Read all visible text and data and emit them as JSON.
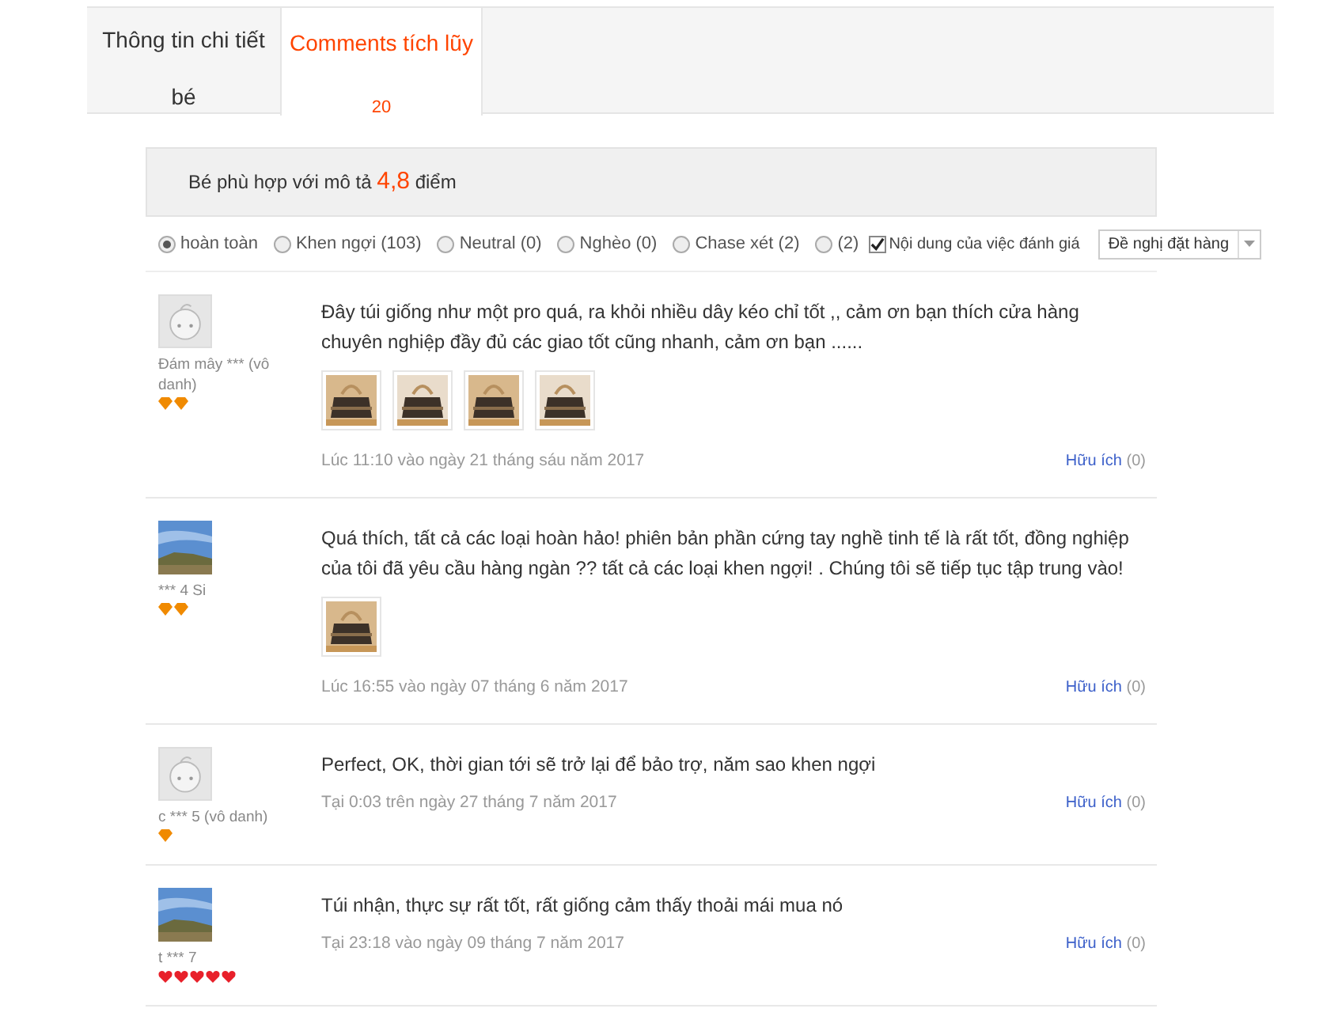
{
  "tabs": [
    {
      "label": "Thông tin chi tiết bé",
      "selected": false
    },
    {
      "label": "Comments tích lũy",
      "count": "20",
      "selected": true
    }
  ],
  "rating": {
    "label": "Bé phù hợp với mô tả",
    "score": "4,8",
    "unit": "điểm"
  },
  "filters": [
    {
      "label": "hoàn toàn",
      "selected": true
    },
    {
      "label": "Khen ngợi",
      "count": "(103)",
      "selected": false
    },
    {
      "label": "Neutral",
      "count": "(0)",
      "selected": false
    },
    {
      "label": "Nghèo",
      "count": "(0)",
      "selected": false
    },
    {
      "label": "Chase xét",
      "count": "(2)",
      "selected": false
    },
    {
      "count": "(2)",
      "selected": false
    }
  ],
  "content_filter": {
    "label": "Nội dung của việc đánh giá",
    "checked": true
  },
  "sort": {
    "value": "Đề nghị đặt hàng"
  },
  "reviews": [
    {
      "avatar": {
        "kind": "default"
      },
      "user": "Đám mây *** (vô danh)",
      "badges": [
        {
          "kind": "diamond"
        },
        {
          "kind": "diamond"
        }
      ],
      "text": "Đây túi giống như một pro quá, ra khỏi nhiều dây kéo chỉ tốt ,, cảm ơn bạn thích cửa hàng chuyên nghiệp đầy đủ các giao tốt cũng nhanh, cảm ơn bạn ......",
      "images": [
        {
          "kind": "picture"
        },
        {
          "kind": "picture"
        },
        {
          "kind": "picture"
        },
        {
          "kind": "picture"
        }
      ],
      "date": "Lúc 11:10 vào ngày 21 tháng sáu năm 2017",
      "helpful": "Hữu ích",
      "helpful_count": "(0)"
    },
    {
      "avatar": {
        "kind": "picture"
      },
      "user": "*** 4 Si",
      "badges": [
        {
          "kind": "diamond"
        },
        {
          "kind": "diamond"
        }
      ],
      "text": "Quá thích, tất cả các loại hoàn hảo! phiên bản phần cứng tay nghề tinh tế là rất tốt, đồng nghiệp của tôi đã yêu cầu hàng ngàn ?? tất cả các loại khen ngợi! . Chúng tôi sẽ tiếp tục tập trung vào!",
      "images": [
        {
          "kind": "picture"
        }
      ],
      "date": "Lúc 16:55 vào ngày 07 tháng 6 năm 2017",
      "helpful": "Hữu ích",
      "helpful_count": "(0)"
    },
    {
      "avatar": {
        "kind": "default"
      },
      "user": "c *** 5 (vô danh)",
      "badges": [
        {
          "kind": "diamond"
        }
      ],
      "text": "Perfect, OK, thời gian tới sẽ trở lại để bảo trợ, năm sao khen ngợi",
      "date": "Tại 0:03 trên ngày 27 tháng 7 năm 2017",
      "helpful": "Hữu ích",
      "helpful_count": "(0)"
    },
    {
      "avatar": {
        "kind": "picture"
      },
      "user": "t *** 7",
      "badges": [
        {
          "kind": "heart"
        },
        {
          "kind": "heart"
        },
        {
          "kind": "heart"
        },
        {
          "kind": "heart"
        },
        {
          "kind": "heart"
        }
      ],
      "text": "Túi nhận, thực sự rất tốt, rất giống cảm thấy thoải mái mua nó",
      "date": "Tại 23:18 vào ngày 09 tháng 7 năm 2017",
      "helpful": "Hữu ích",
      "helpful_count": "(0)"
    }
  ]
}
